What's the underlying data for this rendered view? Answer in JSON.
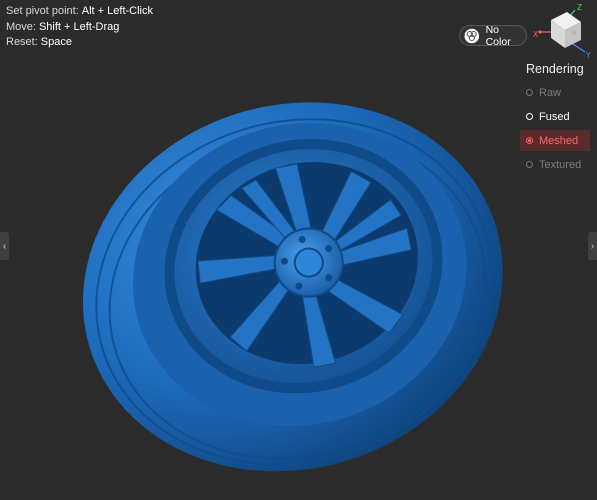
{
  "hints": [
    {
      "label": "Set pivot point:",
      "value": "Alt + Left-Click"
    },
    {
      "label": "Move:",
      "value": "Shift + Left-Drag"
    },
    {
      "label": "Reset:",
      "value": "Space"
    }
  ],
  "color_toggle": {
    "label": "No Color"
  },
  "rendering": {
    "title": "Rendering",
    "options": [
      {
        "label": "Raw",
        "state": "inactive"
      },
      {
        "label": "Fused",
        "state": "fused"
      },
      {
        "label": "Meshed",
        "state": "selected"
      },
      {
        "label": "Textured",
        "state": "inactive"
      }
    ]
  },
  "gizmo": {
    "axes": {
      "z": "Z",
      "x": "X",
      "y": "Y"
    },
    "z_color": "#3fd25a",
    "x_color": "#ff5a5a",
    "y_color": "#3b8cff"
  },
  "nav": {
    "prev": "‹",
    "next": "›"
  },
  "model": {
    "color": "#1f6fc1"
  }
}
